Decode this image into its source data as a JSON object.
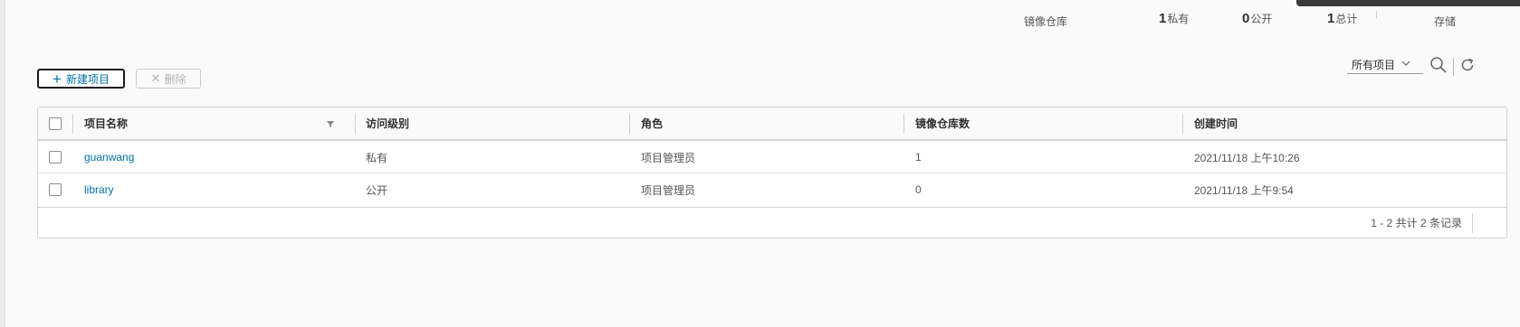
{
  "stats": {
    "repo_label": "镜像仓库",
    "private_count": "1",
    "private_label": "私有",
    "public_count": "0",
    "public_label": "公开",
    "total_count": "1",
    "total_label": "总计",
    "storage_label": "存储"
  },
  "toolbar": {
    "new_project_label": "新建项目",
    "delete_label": "删除",
    "filter_value": "所有项目"
  },
  "table": {
    "headers": {
      "name": "项目名称",
      "access": "访问级别",
      "role": "角色",
      "repo_count": "镜像仓库数",
      "created": "创建时间"
    },
    "rows": [
      {
        "name": "guanwang",
        "access": "私有",
        "role": "项目管理员",
        "repo_count": "1",
        "created": "2021/11/18 上午10:26"
      },
      {
        "name": "library",
        "access": "公开",
        "role": "项目管理员",
        "repo_count": "0",
        "created": "2021/11/18 上午9:54"
      }
    ],
    "footer": "1 - 2 共计 2 条记录"
  },
  "icons": {
    "search": "search-icon",
    "refresh": "refresh-icon",
    "filter": "filter-icon",
    "plus": "plus-icon",
    "close": "close-icon",
    "chevron": "chevron-down-icon"
  },
  "colors": {
    "link": "#0072a3",
    "text": "#565656",
    "border": "#d4d4d4"
  }
}
